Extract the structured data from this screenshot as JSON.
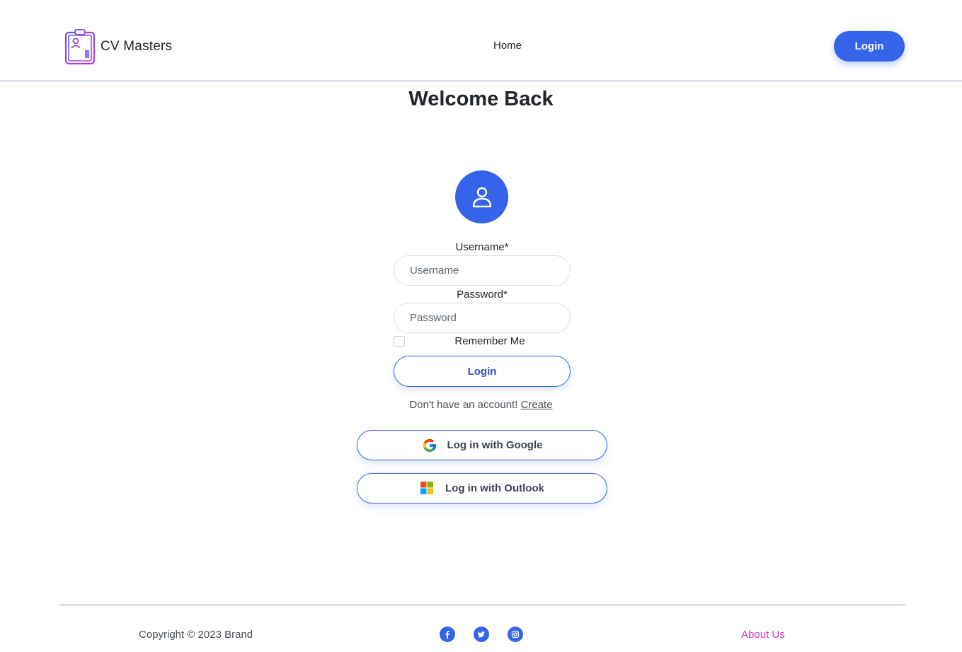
{
  "header": {
    "brand_name": "CV Masters",
    "nav_home": "Home",
    "login_button": "Login"
  },
  "page": {
    "title": "Welcome Back"
  },
  "form": {
    "username_label": "Username*",
    "username_placeholder": "Username",
    "password_label": "Password*",
    "password_placeholder": "Password",
    "remember_label": "Remember Me",
    "remember_checked": false,
    "login_button": "Login",
    "signup_text": "Don't have an account!",
    "signup_link": "Create"
  },
  "social_login": {
    "google_label": "Log in with Google",
    "outlook_label": "Log in with Outlook"
  },
  "footer": {
    "copyright": "Copyright © 2023 Brand",
    "social_icons": [
      "facebook-icon",
      "twitter-icon",
      "instagram-icon"
    ],
    "about_link": "About Us"
  },
  "colors": {
    "primary": "#3563e9",
    "text": "#212529",
    "about_link": "#d63ac8",
    "divider": "#7f97c2"
  }
}
